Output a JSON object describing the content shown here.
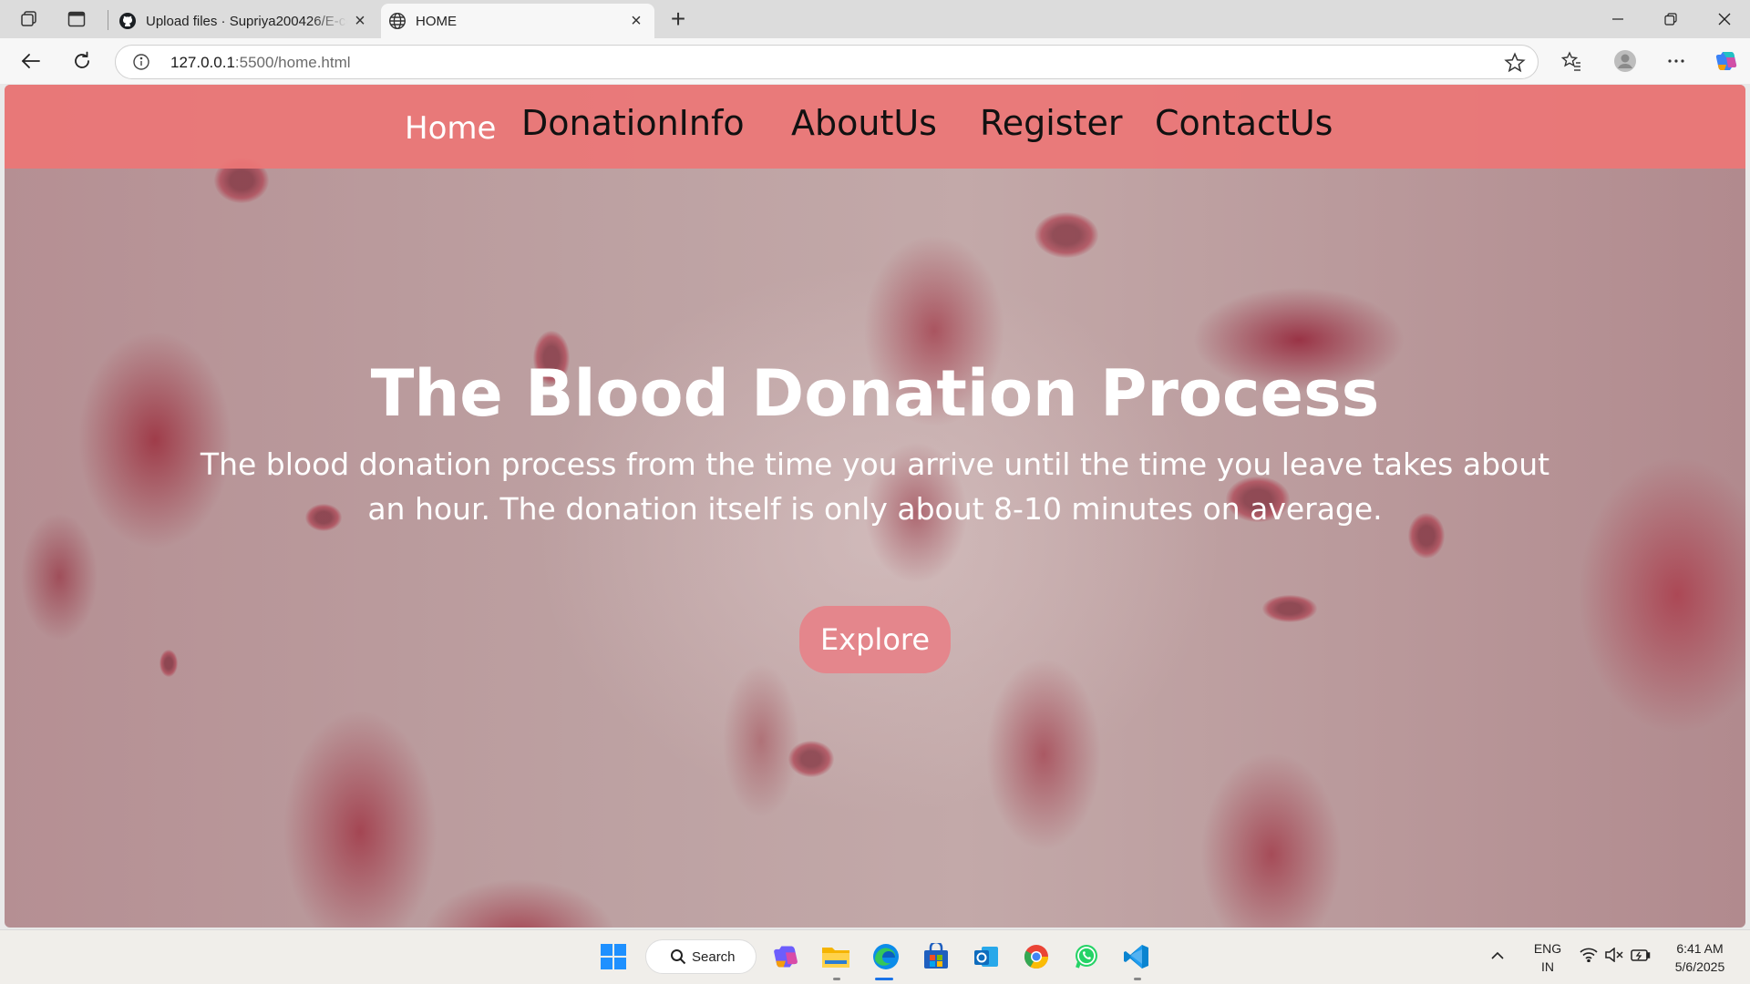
{
  "browser": {
    "tabs": [
      {
        "title": "Upload files · Supriya200426/E-co",
        "favicon": "github-icon",
        "active": false
      },
      {
        "title": "HOME",
        "favicon": "globe-icon",
        "active": true
      }
    ],
    "url_host": "127.0.0.1",
    "url_rest": ":5500/home.html"
  },
  "site": {
    "nav": [
      {
        "label": "Home",
        "active": true
      },
      {
        "label": "DonationInfo",
        "active": false
      },
      {
        "label": "AboutUs",
        "active": false
      },
      {
        "label": "Register",
        "active": false
      },
      {
        "label": "ContactUs",
        "active": false
      }
    ],
    "hero": {
      "title": "The Blood Donation Process",
      "text": "The blood donation process from the time you arrive until the time you leave takes about an hour. The donation itself is only about 8-10 minutes on average.",
      "button": "Explore"
    },
    "colors": {
      "nav_bg": "#ec7676",
      "button_bg": "#e4868c"
    }
  },
  "taskbar": {
    "search_label": "Search",
    "language": "ENG",
    "region": "IN",
    "time": "6:41 AM",
    "date": "5/6/2025"
  }
}
